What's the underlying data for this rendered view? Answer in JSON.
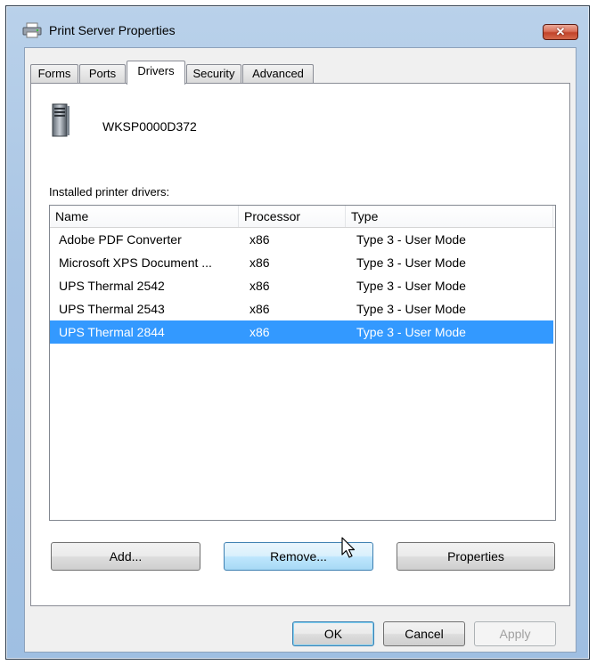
{
  "window": {
    "title": "Print Server Properties",
    "close_label": "✕"
  },
  "tabs": [
    {
      "label": "Forms"
    },
    {
      "label": "Ports"
    },
    {
      "label": "Drivers"
    },
    {
      "label": "Security"
    },
    {
      "label": "Advanced"
    }
  ],
  "active_tab": "Drivers",
  "server": {
    "name": "WKSP0000D372"
  },
  "drivers_list": {
    "label": "Installed printer drivers:",
    "columns": [
      "Name",
      "Processor",
      "Type"
    ],
    "rows": [
      {
        "name": "Adobe PDF Converter",
        "processor": "x86",
        "type": "Type 3 - User Mode"
      },
      {
        "name": "Microsoft XPS Document ...",
        "processor": "x86",
        "type": "Type 3 - User Mode"
      },
      {
        "name": "UPS Thermal 2542",
        "processor": "x86",
        "type": "Type 3 - User Mode"
      },
      {
        "name": "UPS Thermal 2543",
        "processor": "x86",
        "type": "Type 3 - User Mode"
      },
      {
        "name": "UPS Thermal 2844",
        "processor": "x86",
        "type": "Type 3 - User Mode",
        "selected": true
      }
    ]
  },
  "buttons": {
    "add": "Add...",
    "remove": "Remove...",
    "properties": "Properties",
    "ok": "OK",
    "cancel": "Cancel",
    "apply": "Apply"
  },
  "colors": {
    "selection": "#3399ff",
    "close_button": "#c2432a"
  }
}
